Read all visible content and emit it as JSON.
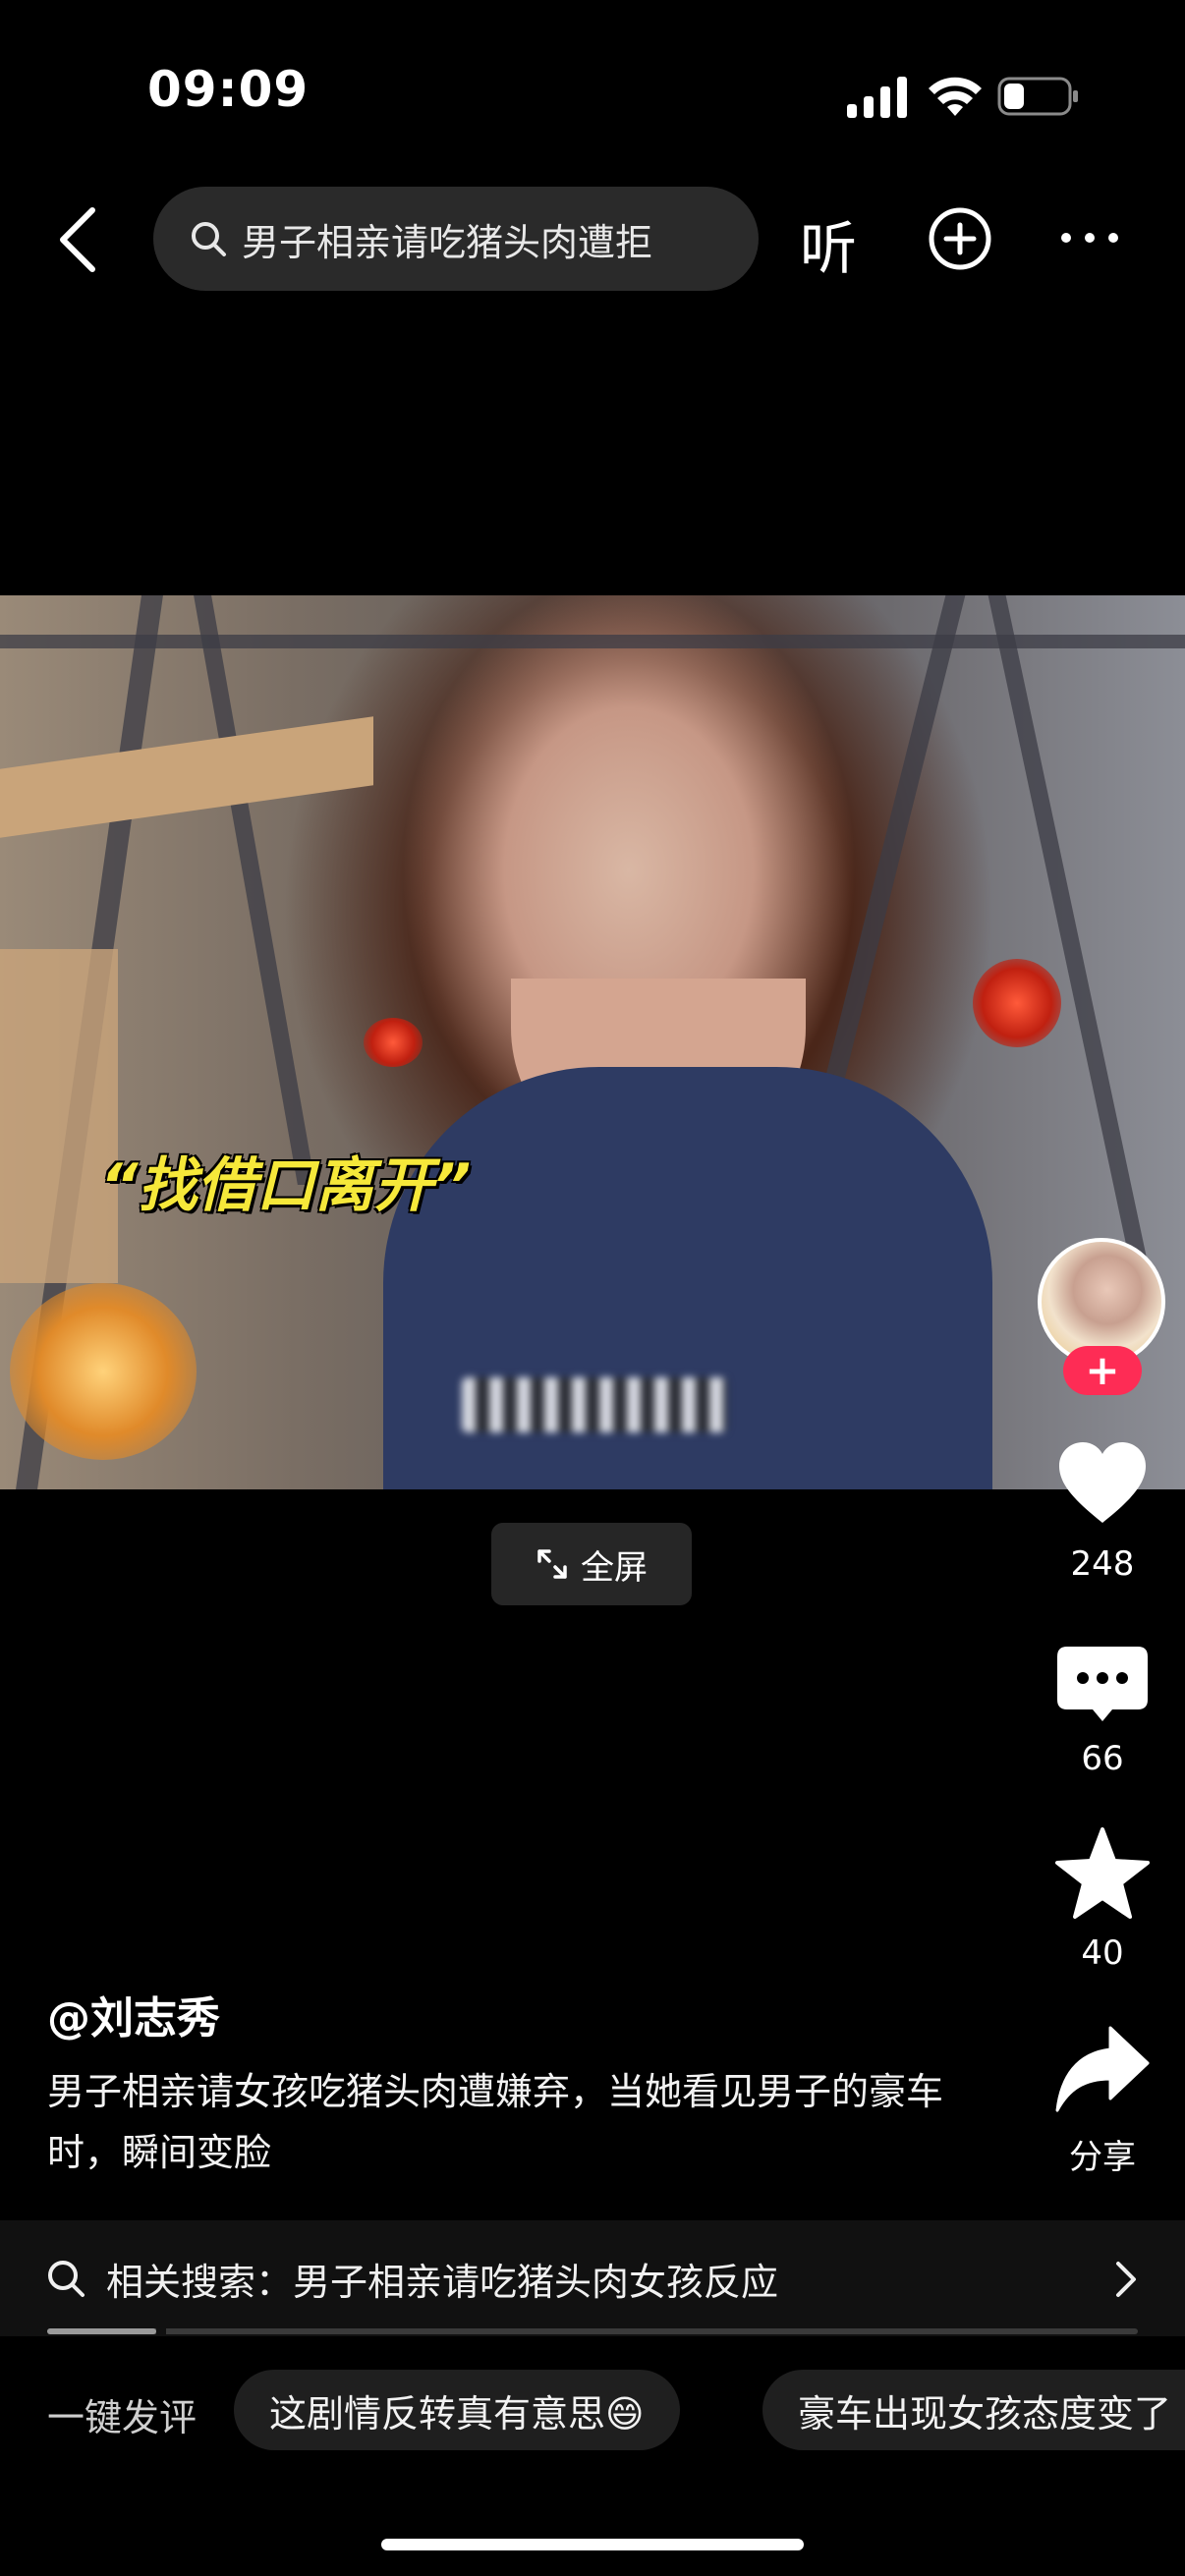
{
  "status_bar": {
    "time": "09:09",
    "icons": [
      "signal-icon",
      "wifi-icon",
      "battery-icon"
    ]
  },
  "top_bar": {
    "search_text": "男子相亲请吃猪头肉遭拒",
    "listen_label": "听",
    "icons": [
      "back-icon",
      "search-icon",
      "add-icon",
      "more-icon"
    ]
  },
  "video": {
    "caption_quote": "“找借口离开”",
    "fullscreen_label": "全屏"
  },
  "right_rail": {
    "follow_label": "+",
    "likes": "248",
    "comments": "66",
    "favorites": "40",
    "share_label": "分享"
  },
  "post": {
    "author": "@刘志秀",
    "description": "男子相亲请女孩吃猪头肉遭嫌弃，当她看见男子的豪车时，瞬间变脸"
  },
  "related_search": {
    "text": "相关搜索：男子相亲请吃猪头肉女孩反应"
  },
  "progress": {
    "fraction": 0.1
  },
  "quick_comment": {
    "label": "一键发评",
    "chips": [
      "这剧情反转真有意思😄",
      "豪车出现女孩态度变了"
    ]
  },
  "colors": {
    "background": "#000000",
    "accent_red": "#fe2c55",
    "caption_yellow": "#f6e83a"
  }
}
